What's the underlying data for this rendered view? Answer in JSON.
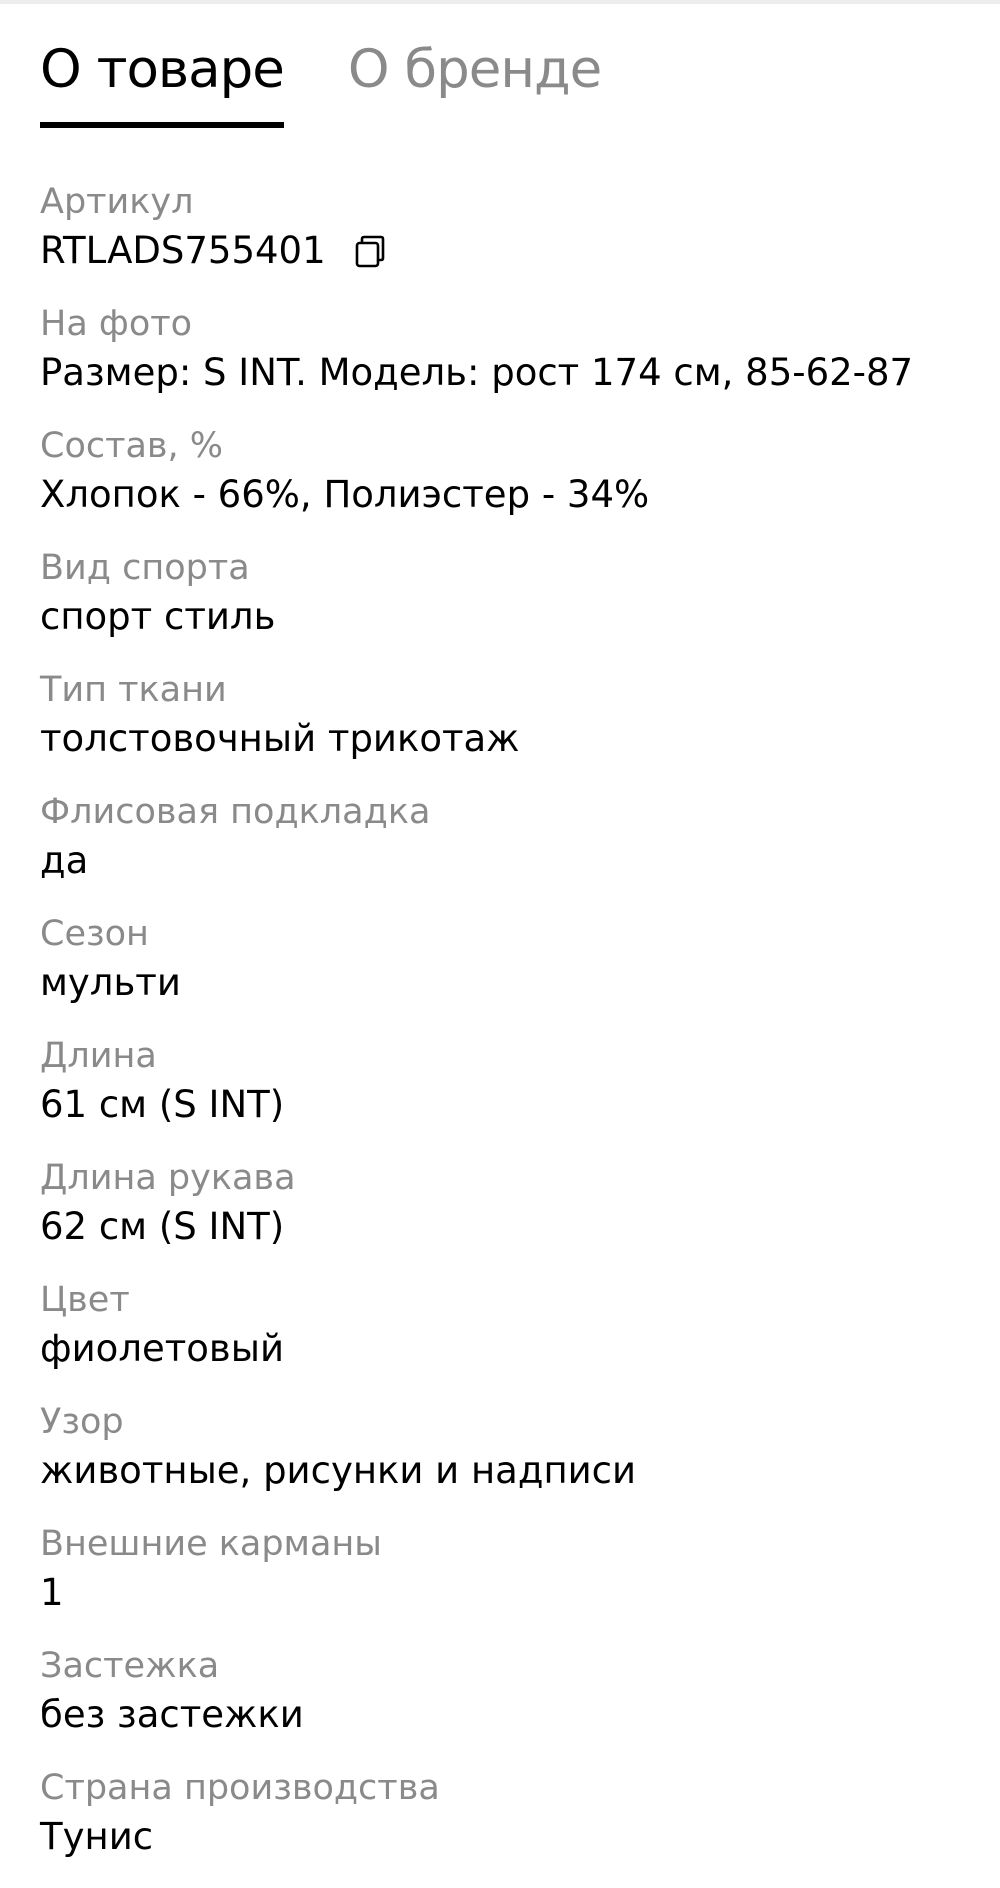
{
  "tabs": {
    "active_label": "О товаре",
    "inactive_label": "О бренде"
  },
  "properties": [
    {
      "label": "Артикул",
      "value": "RTLADS755401",
      "icon": "copy-icon"
    },
    {
      "label": "На фото",
      "value": "Размер: S INT. Модель: рост 174 см, 85-62-87"
    },
    {
      "label": "Состав, %",
      "value": "Хлопок - 66%, Полиэстер - 34%"
    },
    {
      "label": "Вид спорта",
      "value": "спорт стиль"
    },
    {
      "label": "Тип ткани",
      "value": "толстовочный трикотаж"
    },
    {
      "label": "Флисовая подкладка",
      "value": "да"
    },
    {
      "label": "Сезон",
      "value": "мульти"
    },
    {
      "label": "Длина",
      "value": "61 см (S INT)"
    },
    {
      "label": "Длина рукава",
      "value": "62 см (S INT)"
    },
    {
      "label": "Цвет",
      "value": "фиолетовый"
    },
    {
      "label": "Узор",
      "value": "животные, рисунки и надписи"
    },
    {
      "label": "Внешние карманы",
      "value": "1"
    },
    {
      "label": "Застежка",
      "value": "без застежки"
    },
    {
      "label": "Страна производства",
      "value": "Тунис"
    }
  ],
  "colors": {
    "text_primary": "#000000",
    "text_secondary": "#8a8a8a",
    "background": "#ffffff"
  }
}
